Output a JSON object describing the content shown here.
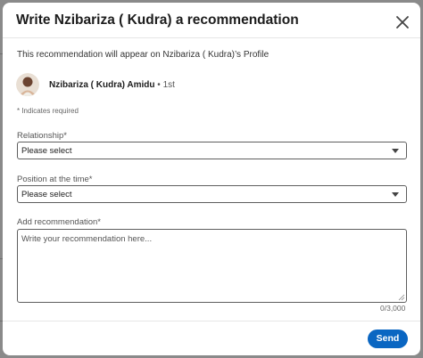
{
  "modal": {
    "title": "Write Nzibariza ( Kudra) a recommendation",
    "close_icon": "close-icon"
  },
  "notice": "This recommendation will appear on Nzibariza ( Kudra)’s Profile",
  "person": {
    "name": "Nzibariza ( Kudra) Amidu",
    "degree": " • 1st",
    "avatar_icon": "avatar"
  },
  "required_note": "* Indicates required",
  "relationship": {
    "label": "Relationship*",
    "value": "Please select"
  },
  "position": {
    "label": "Position at the time*",
    "value": "Please select"
  },
  "recommendation": {
    "label": "Add recommendation*",
    "placeholder": "Write your recommendation here...",
    "char_count": "0/3,000"
  },
  "footer": {
    "send_label": "Send"
  },
  "colors": {
    "accent": "#0a66c2",
    "backdrop": "#8a8a8a"
  }
}
